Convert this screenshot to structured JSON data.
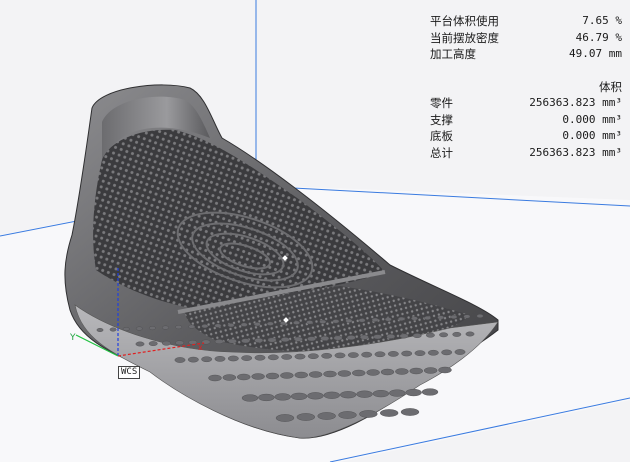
{
  "stats": {
    "platform_usage_label": "平台体积使用",
    "platform_usage_value": "7.65 %",
    "packing_density_label": "当前摆放密度",
    "packing_density_value": "46.79 %",
    "build_height_label": "加工高度",
    "build_height_value": "49.07 mm",
    "volume_header": "体积",
    "part_label": "零件",
    "part_value": "256363.823 mm³",
    "support_label": "支撑",
    "support_value": "0.000 mm³",
    "baseplate_label": "底板",
    "baseplate_value": "0.000 mm³",
    "total_label": "总计",
    "total_value": "256363.823 mm³"
  },
  "axes": {
    "wcs_label": "WCS",
    "y_label": "Y",
    "x_color": "#e02020",
    "y_color": "#20c040",
    "z_color": "#2040e0"
  },
  "colors": {
    "background": "#f3f3f5",
    "floor": "#f7f7f9",
    "platform_edge": "#3a7be0",
    "model_dark": "#3a3a3c",
    "model_mid": "#6a6a6d",
    "model_light": "#a8a8ab"
  }
}
